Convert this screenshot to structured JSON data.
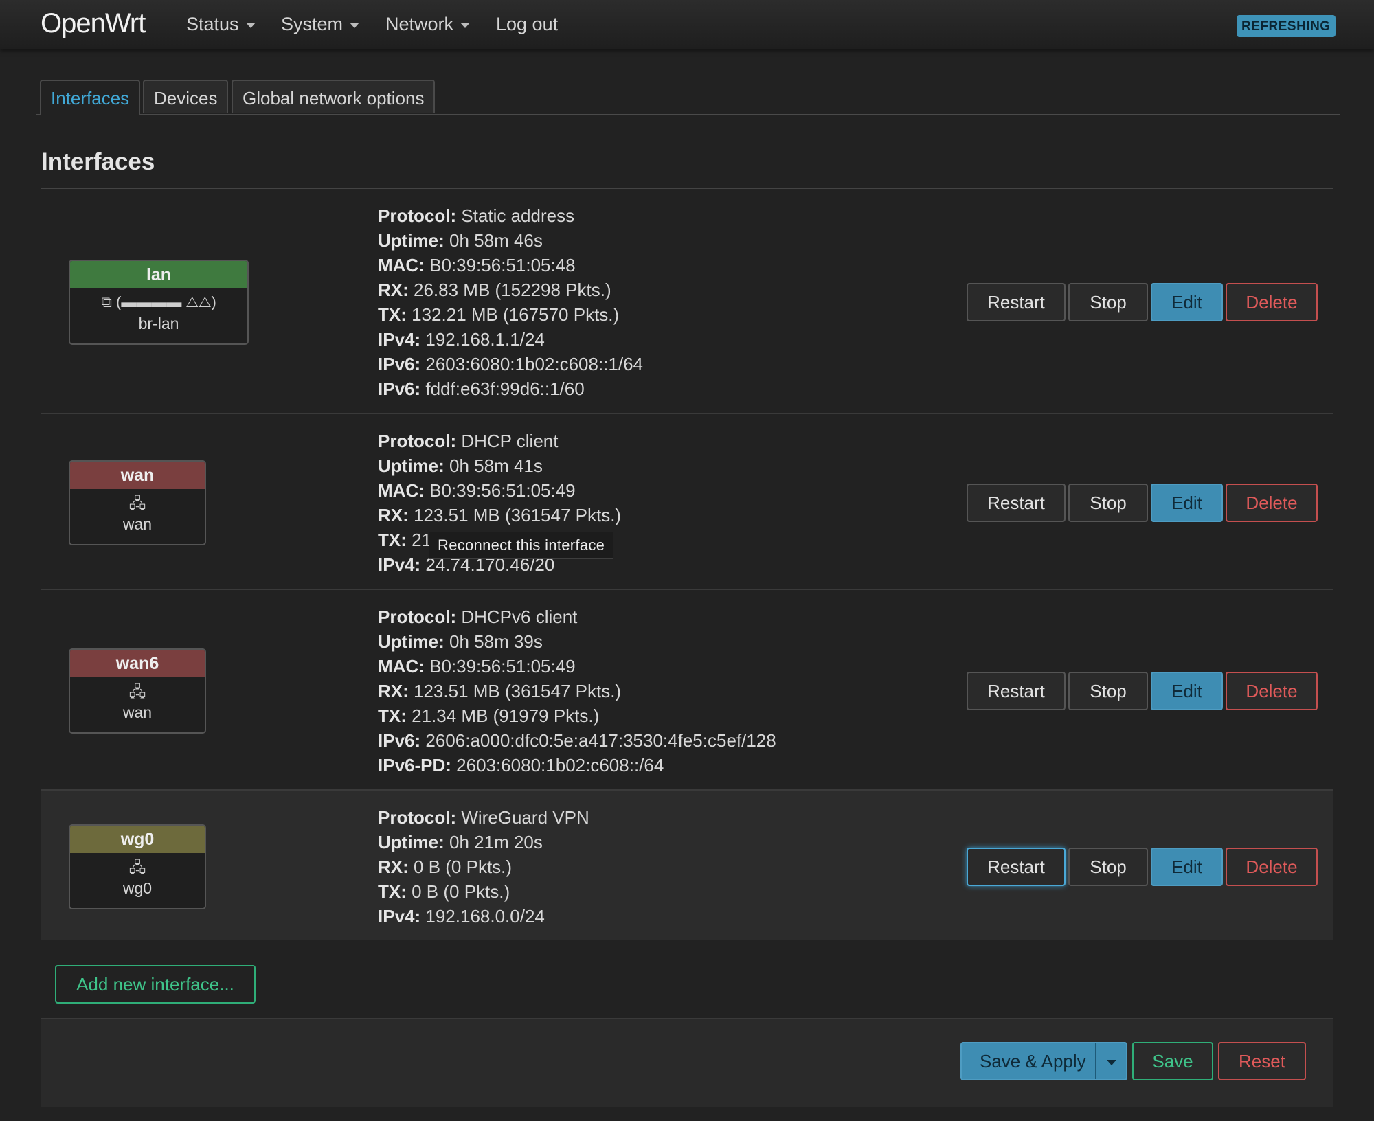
{
  "navbar": {
    "brand": "OpenWrt",
    "menu": [
      "Status",
      "System",
      "Network",
      "Log out"
    ],
    "status_badge": "REFRESHING"
  },
  "tabs": [
    "Interfaces",
    "Devices",
    "Global network options"
  ],
  "section_title": "Interfaces",
  "labels": {
    "protocol": "Protocol:",
    "uptime": "Uptime:",
    "mac": "MAC:",
    "rx": "RX:",
    "tx": "TX:",
    "ipv4": "IPv4:",
    "ipv6": "IPv6:",
    "ipv6pd": "IPv6-PD:"
  },
  "interfaces": [
    {
      "name": "lan",
      "color": "#3f7a3f",
      "device": "br-lan",
      "icons": "(▬▬▬▬ △△)",
      "protocol": "Static address",
      "uptime": "0h 58m 46s",
      "mac": "B0:39:56:51:05:48",
      "rx": "26.83 MB (152298 Pkts.)",
      "tx": "132.21 MB (167570 Pkts.)",
      "ipv4": "192.168.1.1/24",
      "ipv6_a": "2603:6080:1b02:c608::1/64",
      "ipv6_b": "fddf:e63f:99d6::1/60"
    },
    {
      "name": "wan",
      "color": "#7a3f3f",
      "device": "wan",
      "protocol": "DHCP client",
      "uptime": "0h 58m 41s",
      "mac": "B0:39:56:51:05:49",
      "rx": "123.51 MB (361547 Pkts.)",
      "tx_visible": "21",
      "ipv4": "24.74.170.46/20"
    },
    {
      "name": "wan6",
      "color": "#7a3f3f",
      "device": "wan",
      "protocol": "DHCPv6 client",
      "uptime": "0h 58m 39s",
      "mac": "B0:39:56:51:05:49",
      "rx": "123.51 MB (361547 Pkts.)",
      "tx": "21.34 MB (91979 Pkts.)",
      "ipv6": "2606:a000:dfc0:5e:a417:3530:4fe5:c5ef/128",
      "ipv6pd": "2603:6080:1b02:c608::/64"
    },
    {
      "name": "wg0",
      "color": "#6d6a3c",
      "device": "wg0",
      "protocol": "WireGuard VPN",
      "uptime": "0h 21m 20s",
      "rx": "0 B (0 Pkts.)",
      "tx": "0 B (0 Pkts.)",
      "ipv4": "192.168.0.0/24"
    }
  ],
  "buttons": {
    "restart": "Restart",
    "stop": "Stop",
    "edit": "Edit",
    "delete": "Delete",
    "add_interface": "Add new interface...",
    "save_apply": "Save & Apply",
    "save": "Save",
    "reset": "Reset"
  },
  "tooltip": "Reconnect this interface"
}
